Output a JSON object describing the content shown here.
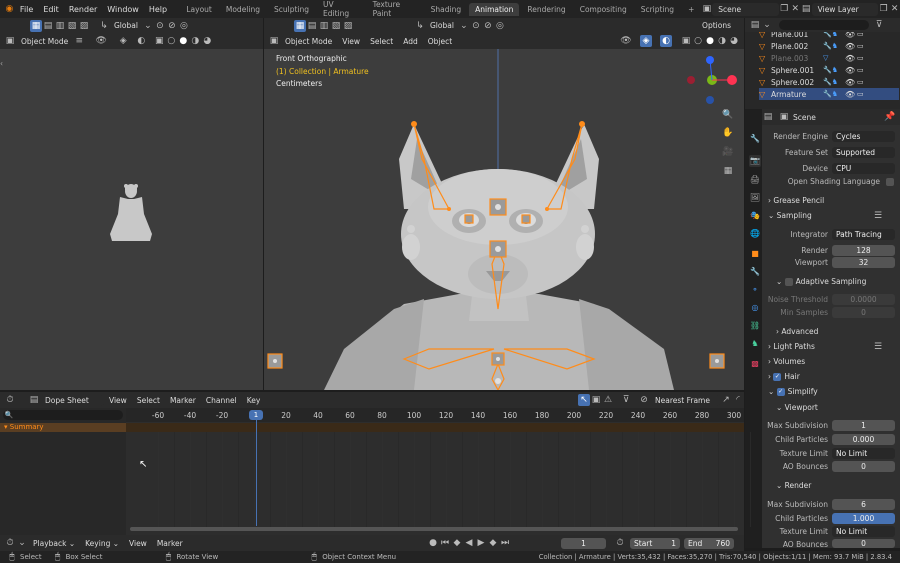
{
  "menus": [
    "File",
    "Edit",
    "Render",
    "Window",
    "Help"
  ],
  "workspaces": [
    {
      "label": "Layout",
      "active": false
    },
    {
      "label": "Modeling",
      "active": false
    },
    {
      "label": "Sculpting",
      "active": false
    },
    {
      "label": "UV Editing",
      "active": false
    },
    {
      "label": "Texture Paint",
      "active": false
    },
    {
      "label": "Shading",
      "active": false
    },
    {
      "label": "Animation",
      "active": true
    },
    {
      "label": "Rendering",
      "active": false
    },
    {
      "label": "Compositing",
      "active": false
    },
    {
      "label": "Scripting",
      "active": false
    }
  ],
  "add_tab": "+",
  "scene_name": "Scene",
  "view_layer": "View Layer",
  "left_toolbar": {
    "orientation": "Global",
    "mode": "Object Mode"
  },
  "main_toolbar": {
    "orientation": "Global",
    "options": "Options",
    "mode": "Object Mode",
    "menus": [
      "View",
      "Select",
      "Add",
      "Object"
    ]
  },
  "viewport_overlay": {
    "view": "Front Orthographic",
    "collection": "(1) Collection | Armature",
    "units": "Centimeters"
  },
  "outliner": {
    "search_placeholder": "",
    "items": [
      {
        "name": "Plane.001",
        "dim": false
      },
      {
        "name": "Plane.002",
        "dim": false
      },
      {
        "name": "Plane.003",
        "dim": true
      },
      {
        "name": "Sphere.001",
        "dim": false
      },
      {
        "name": "Sphere.002",
        "dim": false
      },
      {
        "name": "Armature",
        "dim": false
      }
    ]
  },
  "properties": {
    "scene_label": "Scene",
    "render_engine_label": "Render Engine",
    "render_engine": "Cycles",
    "feature_set_label": "Feature Set",
    "feature_set": "Supported",
    "device_label": "Device",
    "device": "CPU",
    "osl_label": "Open Shading Language",
    "grease_pencil": "Grease Pencil",
    "sampling": "Sampling",
    "integrator_label": "Integrator",
    "integrator": "Path Tracing",
    "render_label": "Render",
    "render_samples": "128",
    "viewport_label": "Viewport",
    "viewport_samples": "32",
    "adaptive_sampling": "Adaptive Sampling",
    "noise_threshold_label": "Noise Threshold",
    "noise_threshold": "0.0000",
    "min_samples_label": "Min Samples",
    "min_samples": "0",
    "advanced": "Advanced",
    "light_paths": "Light Paths",
    "volumes": "Volumes",
    "hair": "Hair",
    "simplify": "Simplify",
    "viewport_sub": "Viewport",
    "max_subdiv_label": "Max Subdivision",
    "vp_max_subdiv": "1",
    "child_particles_label": "Child Particles",
    "vp_child_particles": "0.000",
    "texture_limit_label": "Texture Limit",
    "vp_texture_limit": "No Limit",
    "ao_bounces_label": "AO Bounces",
    "vp_ao_bounces": "0",
    "render_sub": "Render",
    "r_max_subdiv": "6",
    "r_child_particles": "1.000",
    "r_texture_limit": "No Limit",
    "r_ao_bounces": "0"
  },
  "dopesheet": {
    "mode": "Dope Sheet",
    "menus": [
      "View",
      "Select",
      "Marker",
      "Channel",
      "Key"
    ],
    "snap": "Nearest Frame",
    "summary": "Summary",
    "ticks": [
      "-60",
      "-40",
      "-20",
      "1",
      "20",
      "40",
      "60",
      "80",
      "100",
      "120",
      "140",
      "160",
      "180",
      "200",
      "220",
      "240",
      "260",
      "280",
      "300"
    ],
    "current_frame": "1"
  },
  "timeline": {
    "menus": [
      "Playback",
      "Keying",
      "View",
      "Marker"
    ],
    "current_frame": "1",
    "start_label": "Start",
    "start": "1",
    "end_label": "End",
    "end": "760"
  },
  "statusbar": {
    "select": "Select",
    "box_select": "Box Select",
    "rotate_view": "Rotate View",
    "context_menu": "Object Context Menu",
    "stats": "Collection | Armature | Verts:35,432 | Faces:35,270 | Tris:70,540 | Objects:1/11 | Mem: 93.7 MiB | 2.83.4"
  },
  "colors": {
    "accent": "#4772b3",
    "selection": "#ff8c1a",
    "active_item": "#334d80"
  }
}
